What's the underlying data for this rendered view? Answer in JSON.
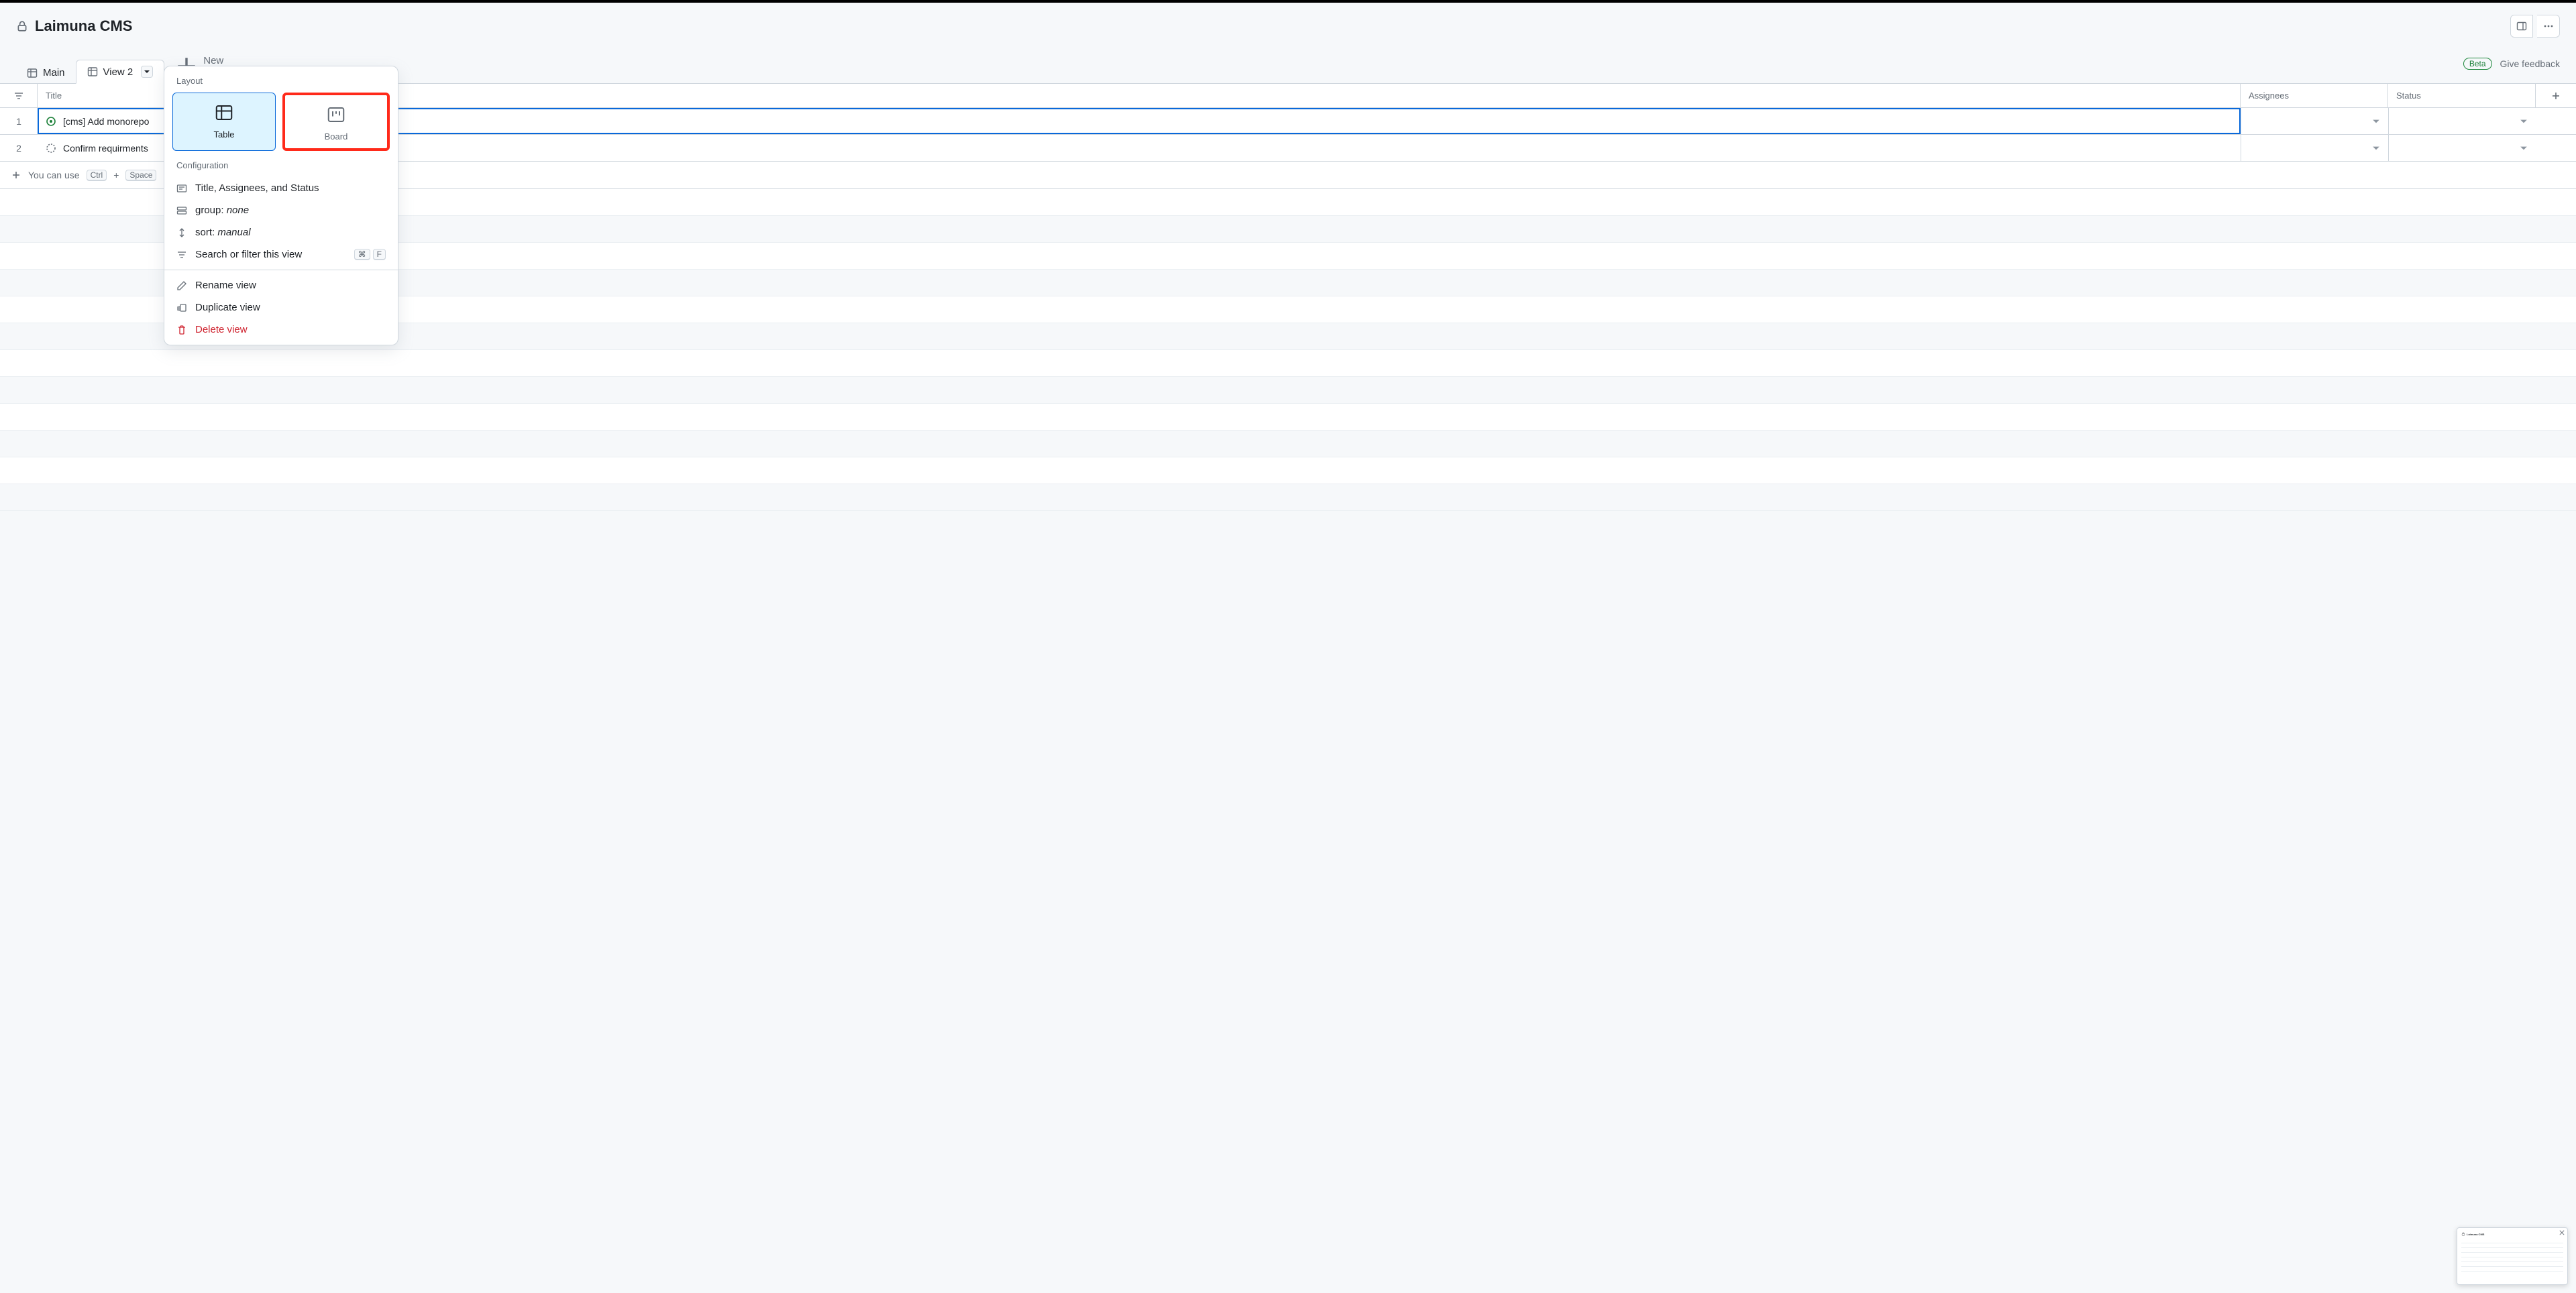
{
  "header": {
    "title": "Laimuna CMS"
  },
  "tabs": {
    "items": [
      {
        "label": "Main",
        "active": false
      },
      {
        "label": "View 2",
        "active": true
      }
    ],
    "new_view": "New view"
  },
  "topright": {
    "beta": "Beta",
    "feedback": "Give feedback"
  },
  "columns": {
    "title": "Title",
    "assignees": "Assignees",
    "status": "Status"
  },
  "rows": [
    {
      "num": "1",
      "title": "[cms] Add monorepo",
      "kind": "open"
    },
    {
      "num": "2",
      "title": "Confirm requirments",
      "kind": "draft"
    }
  ],
  "footer": {
    "prefix": "You can use",
    "kbd1": "Ctrl",
    "plus": "+",
    "kbd2": "Space"
  },
  "popover": {
    "layout_label": "Layout",
    "layout_table": "Table",
    "layout_board": "Board",
    "config_label": "Configuration",
    "fields_line": "Title, Assignees, and Status",
    "group_prefix": "group: ",
    "group_value": "none",
    "sort_prefix": "sort: ",
    "sort_value": "manual",
    "search_filter": "Search or filter this view",
    "search_kbd1": "⌘",
    "search_kbd2": "F",
    "rename": "Rename view",
    "duplicate": "Duplicate view",
    "delete": "Delete view"
  },
  "thumb": {
    "title": "Laimuna CMS"
  }
}
